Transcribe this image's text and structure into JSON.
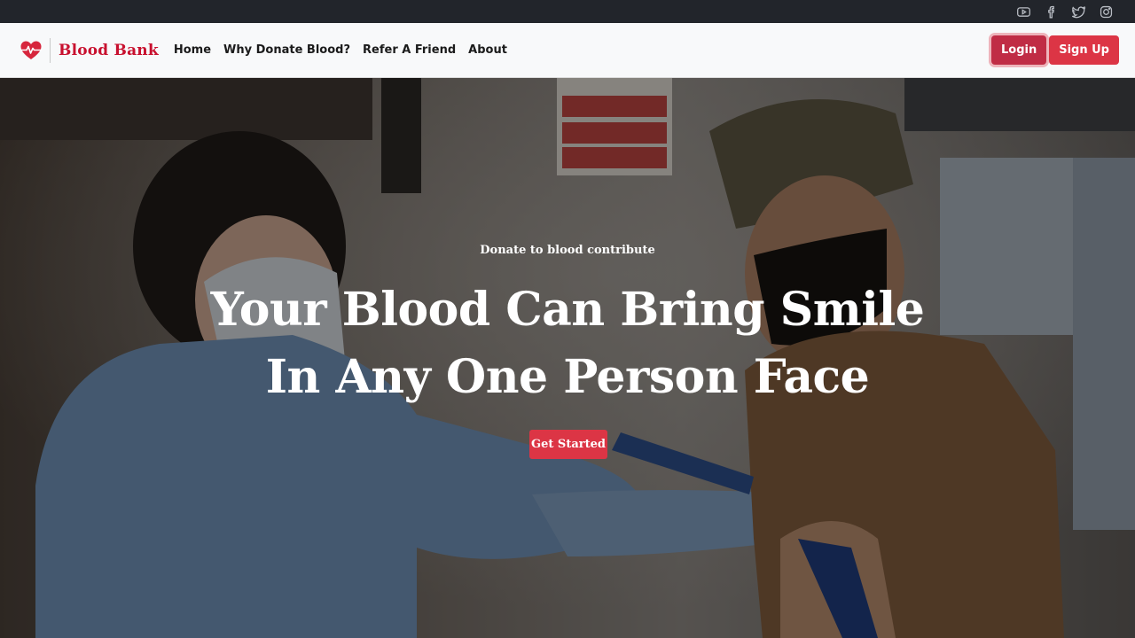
{
  "social": {
    "icons": [
      "youtube-icon",
      "facebook-icon",
      "twitter-icon",
      "instagram-icon"
    ],
    "color": "#b9bdc4"
  },
  "brand": {
    "name": "Blood Bank",
    "logo_icon": "heart-pulse-icon",
    "color": "#c8102e"
  },
  "nav": {
    "links": [
      "Home",
      "Why Donate Blood?",
      "Refer A Friend",
      "About"
    ],
    "login_label": "Login",
    "signup_label": "Sign Up"
  },
  "hero": {
    "kicker": "Donate to blood contribute",
    "title_line1": "Your Blood Can Bring Smile",
    "title_line2": "In Any One Person Face",
    "cta_label": "Get Started"
  },
  "colors": {
    "topbar": "#22252b",
    "navbar": "#f8f9fa",
    "accent": "#dc3545"
  }
}
